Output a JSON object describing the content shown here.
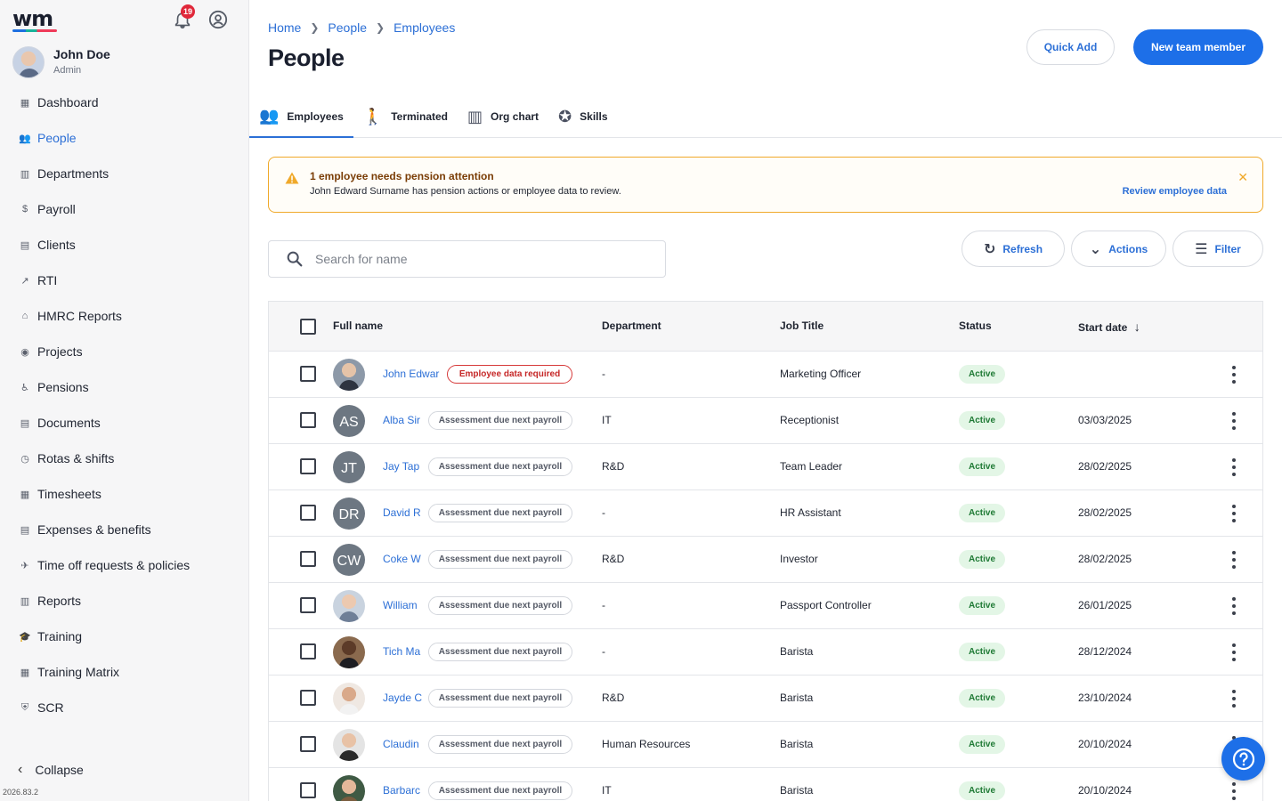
{
  "sidebar": {
    "logo_text": "wm",
    "notification_count": "19",
    "user": {
      "name": "John Doe",
      "role": "Admin"
    },
    "nav": [
      {
        "label": "Dashboard",
        "icon": "dashboard-icon",
        "glyph": "▦"
      },
      {
        "label": "People",
        "icon": "people-icon",
        "glyph": "👥",
        "active": true
      },
      {
        "label": "Departments",
        "icon": "building-icon",
        "glyph": "▥"
      },
      {
        "label": "Payroll",
        "icon": "dollar-icon",
        "glyph": "$"
      },
      {
        "label": "Clients",
        "icon": "clients-icon",
        "glyph": "▤"
      },
      {
        "label": "RTI",
        "icon": "trend-icon",
        "glyph": "↗"
      },
      {
        "label": "HMRC Reports",
        "icon": "bank-icon",
        "glyph": "⌂"
      },
      {
        "label": "Projects",
        "icon": "globe-icon",
        "glyph": "◉"
      },
      {
        "label": "Pensions",
        "icon": "elderly-icon",
        "glyph": "♿"
      },
      {
        "label": "Documents",
        "icon": "document-icon",
        "glyph": "▤"
      },
      {
        "label": "Rotas & shifts",
        "icon": "clock-icon",
        "glyph": "◷"
      },
      {
        "label": "Timesheets",
        "icon": "calendar-icon",
        "glyph": "▦"
      },
      {
        "label": "Expenses & benefits",
        "icon": "receipt-icon",
        "glyph": "▤"
      },
      {
        "label": "Time off requests & policies",
        "icon": "plane-icon",
        "glyph": "✈"
      },
      {
        "label": "Reports",
        "icon": "report-icon",
        "glyph": "▥"
      },
      {
        "label": "Training",
        "icon": "school-icon",
        "glyph": "🎓"
      },
      {
        "label": "Training Matrix",
        "icon": "matrix-icon",
        "glyph": "▦"
      },
      {
        "label": "SCR",
        "icon": "shield-icon",
        "glyph": "⛨"
      }
    ],
    "collapse_label": "Collapse",
    "version": "2026.83.2"
  },
  "header": {
    "breadcrumb": [
      "Home",
      "People",
      "Employees"
    ],
    "title": "People",
    "quick_add_label": "Quick Add",
    "new_member_label": "New team member"
  },
  "tabs": [
    {
      "label": "Employees",
      "icon": "people-icon",
      "glyph": "👥",
      "active": true
    },
    {
      "label": "Terminated",
      "icon": "walking-icon",
      "glyph": "🚶"
    },
    {
      "label": "Org chart",
      "icon": "org-chart-icon",
      "glyph": "▥"
    },
    {
      "label": "Skills",
      "icon": "badge-icon",
      "glyph": "✪"
    }
  ],
  "alert": {
    "title": "1 employee needs pension attention",
    "message": "John Edward Surname has pension actions or employee data to review.",
    "link": "Review employee data"
  },
  "search": {
    "placeholder": "Search for name",
    "value": ""
  },
  "toolbar": {
    "refresh_label": "Refresh",
    "actions_label": "Actions",
    "filter_label": "Filter"
  },
  "table": {
    "columns": [
      "Full name",
      "Department",
      "Job Title",
      "Status",
      "Start date"
    ],
    "sort_indicator": "↓",
    "rows": [
      {
        "name": "John Edwar",
        "badge": "Employee data required",
        "badge_type": "req",
        "department": "-",
        "job_title": "Marketing Officer",
        "status": "Active",
        "start_date": "",
        "avatar": {
          "type": "photo",
          "skin": "#e5c3a8",
          "bg": "#8d99a8",
          "cloth": "#2e3440"
        }
      },
      {
        "name": "Alba Sir",
        "badge": "Assessment due next payroll",
        "department": "IT",
        "job_title": "Receptionist",
        "status": "Active",
        "start_date": "03/03/2025",
        "avatar": {
          "type": "initials",
          "initials": "AS"
        }
      },
      {
        "name": "Jay Tap",
        "badge": "Assessment due next payroll",
        "department": "R&D",
        "job_title": "Team Leader",
        "status": "Active",
        "start_date": "28/02/2025",
        "avatar": {
          "type": "initials",
          "initials": "JT"
        }
      },
      {
        "name": "David R",
        "badge": "Assessment due next payroll",
        "department": "-",
        "job_title": "HR Assistant",
        "status": "Active",
        "start_date": "28/02/2025",
        "avatar": {
          "type": "initials",
          "initials": "DR"
        }
      },
      {
        "name": "Coke W",
        "badge": "Assessment due next payroll",
        "department": "R&D",
        "job_title": "Investor",
        "status": "Active",
        "start_date": "28/02/2025",
        "avatar": {
          "type": "initials",
          "initials": "CW"
        }
      },
      {
        "name": "William",
        "badge": "Assessment due next payroll",
        "department": "-",
        "job_title": "Passport Controller",
        "status": "Active",
        "start_date": "26/01/2025",
        "avatar": {
          "type": "photo",
          "skin": "#ecc9b0",
          "bg": "#c9d3df",
          "cloth": "#6f7f97"
        }
      },
      {
        "name": "Tich Ma",
        "badge": "Assessment due next payroll",
        "department": "-",
        "job_title": "Barista",
        "status": "Active",
        "start_date": "28/12/2024",
        "avatar": {
          "type": "photo",
          "skin": "#5c3b28",
          "bg": "#8a6a4e",
          "cloth": "#1d1d22"
        }
      },
      {
        "name": "Jayde C",
        "badge": "Assessment due next payroll",
        "department": "R&D",
        "job_title": "Barista",
        "status": "Active",
        "start_date": "23/10/2024",
        "avatar": {
          "type": "photo",
          "skin": "#d9a98a",
          "bg": "#efe8e2",
          "cloth": "#f2f2f2"
        }
      },
      {
        "name": "Claudin",
        "badge": "Assessment due next payroll",
        "department": "Human Resources",
        "job_title": "Barista",
        "status": "Active",
        "start_date": "20/10/2024",
        "avatar": {
          "type": "photo",
          "skin": "#e8c2a6",
          "bg": "#e4e4e4",
          "cloth": "#2a2a2a"
        }
      },
      {
        "name": "Barbarc",
        "badge": "Assessment due next payroll",
        "department": "IT",
        "job_title": "Barista",
        "status": "Active",
        "start_date": "20/10/2024",
        "avatar": {
          "type": "photo",
          "skin": "#e4b89a",
          "bg": "#3f5a44",
          "cloth": "#7a5c3e"
        }
      }
    ]
  },
  "colors": {
    "accent": "#1d6fe8",
    "link": "#2c6fd6",
    "warning": "#f0a92a",
    "active_status_bg": "#e3f6e6",
    "error": "#d63a3a"
  }
}
